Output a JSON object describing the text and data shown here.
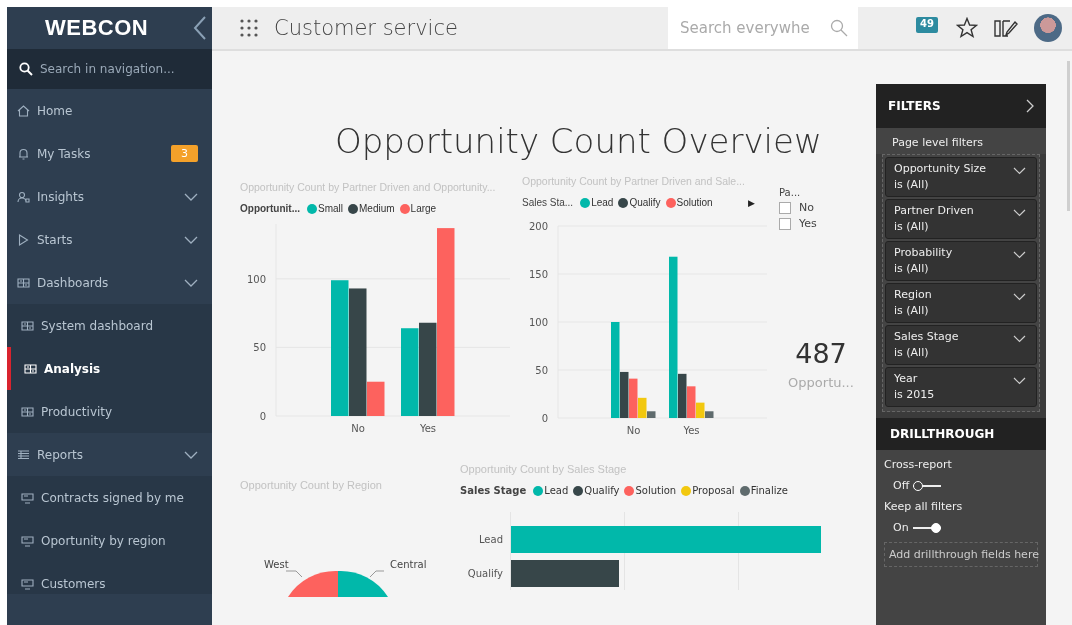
{
  "sidebar": {
    "logo": "WEBCON",
    "search": {
      "placeholder": "Search in navigation..."
    },
    "items": [
      {
        "label": "Home",
        "selected": false
      },
      {
        "label": "My Tasks",
        "badge": "3",
        "selected": false
      },
      {
        "label": "Insights",
        "kind": "group",
        "selected": false
      },
      {
        "label": "Starts",
        "kind": "group",
        "selected": false
      },
      {
        "label": "Dashboards",
        "kind": "group",
        "selected": false,
        "children": [
          {
            "label": "System dashboard",
            "selected": false
          },
          {
            "label": "Analysis",
            "selected": true
          },
          {
            "label": "Productivity",
            "selected": false
          }
        ]
      },
      {
        "label": "Reports",
        "kind": "group",
        "selected": false,
        "children": [
          {
            "label": "Contracts signed by me",
            "selected": false
          },
          {
            "label": "Oportunity by region",
            "selected": false
          },
          {
            "label": "Customers",
            "selected": false
          }
        ]
      }
    ]
  },
  "topbar": {
    "title": "Customer service",
    "search": {
      "placeholder": "Search everywhe"
    },
    "notifications": "49"
  },
  "report": {
    "title": "Opportunity Count Overview",
    "charts": [
      {
        "legend_title": "Opportunit...",
        "chart_data": {
          "type": "bar",
          "title": "Opportunity Count by Partner Driven and Opportunity...",
          "categories": [
            "No",
            "Yes"
          ],
          "ylim": [
            0,
            140
          ],
          "yticks": [
            0,
            50,
            100
          ],
          "grid": true,
          "series": [
            {
              "name": "Small",
              "color": "#01b8aa",
              "values": [
                99,
                64
              ]
            },
            {
              "name": "Medium",
              "color": "#374649",
              "values": [
                93,
                68
              ]
            },
            {
              "name": "Large",
              "color": "#fd625e",
              "values": [
                25,
                137
              ]
            }
          ]
        }
      },
      {
        "legend_title": "Sales Sta...",
        "legend_more": "▶",
        "chart_data": {
          "type": "bar",
          "title": "Opportunity Count by Partner Driven and Sale...",
          "categories": [
            "No",
            "Yes"
          ],
          "ylim": [
            0,
            200
          ],
          "yticks": [
            0,
            50,
            100,
            150,
            200
          ],
          "grid": true,
          "series": [
            {
              "name": "Lead",
              "color": "#01b8aa",
              "values": [
                100,
                168
              ]
            },
            {
              "name": "Qualify",
              "color": "#374649",
              "values": [
                48,
                46
              ]
            },
            {
              "name": "Solution",
              "color": "#fd625e",
              "values": [
                41,
                33
              ]
            },
            {
              "color": "#f2c80f",
              "values": [
                21,
                16
              ]
            },
            {
              "color": "#5f6b6d",
              "values": [
                7,
                7
              ]
            }
          ]
        }
      }
    ],
    "slicer": {
      "title": "Pa...",
      "options": [
        {
          "label": "No",
          "checked": false
        },
        {
          "label": "Yes",
          "checked": false
        }
      ]
    },
    "card": {
      "value": "487",
      "label": "Opportu..."
    },
    "pie": {
      "title": "Opportunity Count by Region",
      "labels": [
        "West",
        "Central"
      ]
    },
    "hbar": {
      "title": "Opportunity Count by Sales Stage",
      "legend_title": "Sales Stage",
      "legend": [
        {
          "name": "Lead",
          "color": "#01b8aa"
        },
        {
          "name": "Qualify",
          "color": "#374649"
        },
        {
          "name": "Solution",
          "color": "#fd625e"
        },
        {
          "name": "Proposal",
          "color": "#f2c80f"
        },
        {
          "name": "Finalize",
          "color": "#5f6b6d"
        }
      ],
      "categories": [
        "Lead",
        "Qualify"
      ]
    }
  },
  "filters": {
    "title": "FILTERS",
    "section": "Page level filters",
    "items": [
      {
        "name": "Opportunity Size",
        "value": "is (All)"
      },
      {
        "name": "Partner Driven",
        "value": "is (All)"
      },
      {
        "name": "Probability",
        "value": "is (All)"
      },
      {
        "name": "Region",
        "value": "is (All)"
      },
      {
        "name": "Sales Stage",
        "value": "is (All)"
      },
      {
        "name": "Year",
        "value": "is 2015"
      }
    ],
    "drillthrough": {
      "title": "DRILLTHROUGH",
      "toggles": [
        {
          "label": "Cross-report",
          "state": "Off",
          "on": false
        },
        {
          "label": "Keep all filters",
          "state": "On",
          "on": true
        }
      ],
      "drop": "Add drillthrough fields here"
    }
  }
}
